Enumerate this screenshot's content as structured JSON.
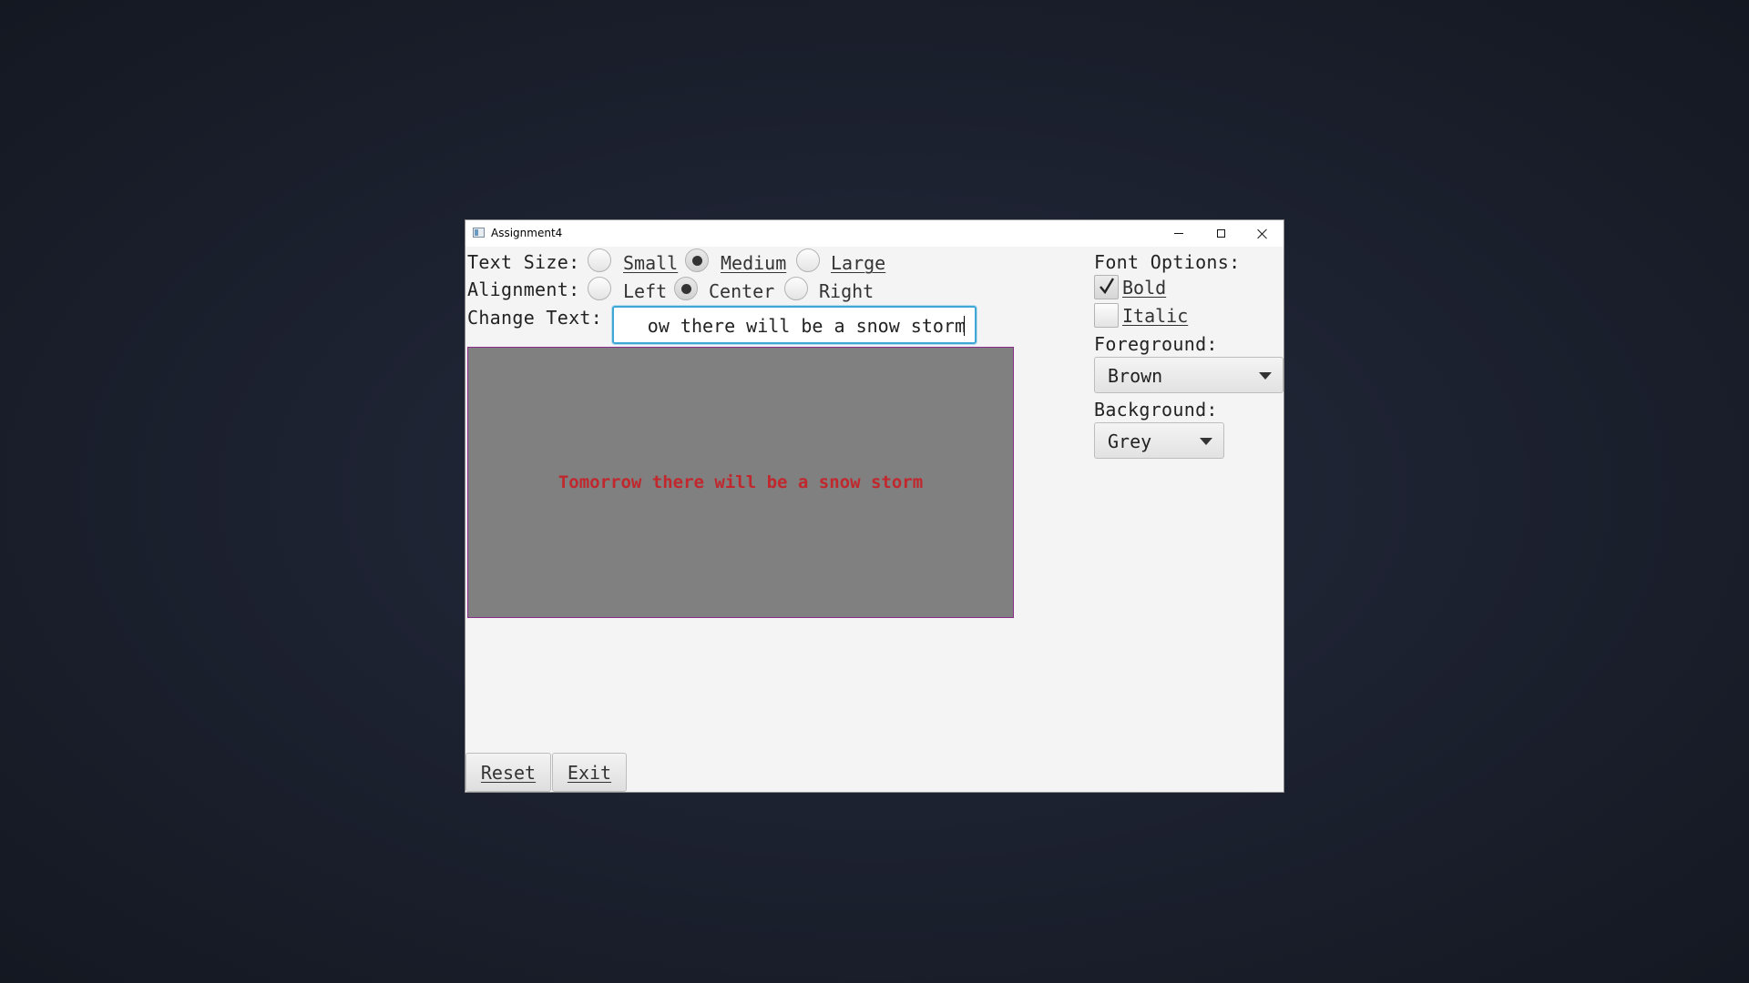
{
  "window": {
    "title": "Assignment4",
    "controls": {
      "minimize": "minimize-icon",
      "maximize": "maximize-icon",
      "close": "close-icon"
    }
  },
  "text_size": {
    "label": "Text Size:",
    "options": [
      "Small",
      "Medium",
      "Large"
    ],
    "selected": "Medium"
  },
  "alignment": {
    "label": "Alignment:",
    "options": [
      "Left",
      "Center",
      "Right"
    ],
    "selected": "Center"
  },
  "change_text": {
    "label": "Change Text:",
    "visible_value": "ow there will be a snow storm"
  },
  "preview": {
    "text": "Tomorrow there will be a snow storm",
    "background_color": "#808080",
    "text_color": "#c0282d",
    "border_color": "#8b2d8b"
  },
  "font_options": {
    "label": "Font Options:",
    "bold": {
      "label": "Bold",
      "checked": true
    },
    "italic": {
      "label": "Italic",
      "checked": false
    }
  },
  "foreground": {
    "label": "Foreground:",
    "selected": "Brown"
  },
  "background": {
    "label": "Background:",
    "selected": "Grey"
  },
  "buttons": {
    "reset": "Reset",
    "exit": "Exit"
  },
  "colors": {
    "focus_accent": "#3fa7d6",
    "desktop": "#1c2130"
  }
}
